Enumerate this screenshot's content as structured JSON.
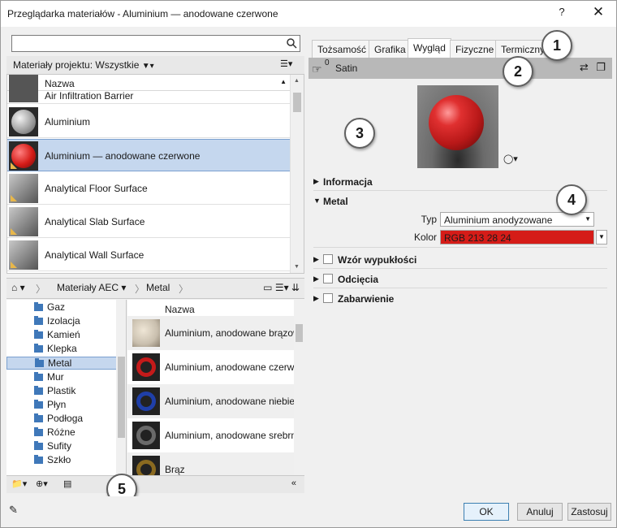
{
  "window": {
    "title": "Przeglądarka materiałów - Aluminium — anodowane czerwone",
    "help_label": "?",
    "close_label": "✕"
  },
  "search": {
    "placeholder": "",
    "icon": "search-icon"
  },
  "project": {
    "header_label": "Materiały projektu: Wszystkie",
    "column_name": "Nazwa",
    "materials": [
      {
        "label": "Air Infiltration Barrier",
        "thumb": "gray-cube"
      },
      {
        "label": "Aluminium",
        "thumb": "silver-sphere"
      },
      {
        "label": "Aluminium — anodowane czerwone",
        "thumb": "red-sphere",
        "selected": true
      },
      {
        "label": "Analytical Floor Surface",
        "thumb": "gray-cube"
      },
      {
        "label": "Analytical Slab Surface",
        "thumb": "gray-cube"
      },
      {
        "label": "Analytical Wall Surface",
        "thumb": "gray-cube"
      }
    ]
  },
  "library": {
    "breadcrumbs": [
      "Materiały AEC",
      "Metal"
    ],
    "tree": [
      "Gaz",
      "Izolacja",
      "Kamień",
      "Klepka",
      "Metal",
      "Mur",
      "Plastik",
      "Płyn",
      "Podłoga",
      "Różne",
      "Sufity",
      "Szkło"
    ],
    "tree_selected": "Metal",
    "column_name": "Nazwa",
    "items": [
      {
        "label": "Aluminium, anodowane brązowe",
        "color": "#c9bfae"
      },
      {
        "label": "Aluminium, anodowane czerwone",
        "color": "#b81a1a"
      },
      {
        "label": "Aluminium, anodowane niebieskie",
        "color": "#1f3fa8"
      },
      {
        "label": "Aluminium, anodowane srebrne",
        "color": "#3a3a3a"
      },
      {
        "label": "Brąz",
        "color": "#8a6a20"
      }
    ]
  },
  "tabs": [
    {
      "label": "Tożsamość"
    },
    {
      "label": "Grafika"
    },
    {
      "label": "Wygląd",
      "active": true
    },
    {
      "label": "Fizyczne"
    },
    {
      "label": "Termiczny"
    }
  ],
  "asset": {
    "count": "0",
    "name": "Satin"
  },
  "sections": {
    "informacja": "Informacja",
    "metal": "Metal",
    "typ_label": "Typ",
    "typ_value": "Aluminium anodyzowane",
    "kolor_label": "Kolor",
    "kolor_value": "RGB 213 28 24",
    "wzor": "Wzór wypukłości",
    "odciecia": "Odcięcia",
    "zabarwienie": "Zabarwienie"
  },
  "colors": {
    "kolor_swatch": "#d51c18",
    "selection": "#c5d7ee"
  },
  "callouts": [
    "1",
    "2",
    "3",
    "4",
    "5"
  ],
  "buttons": {
    "ok": "OK",
    "cancel": "Anuluj",
    "apply": "Zastosuj"
  }
}
